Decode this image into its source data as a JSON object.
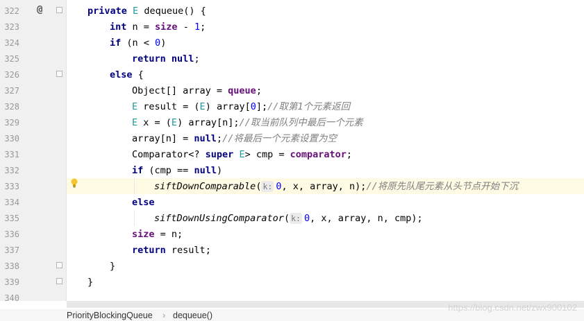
{
  "editor": {
    "line_numbers": [
      "322",
      "323",
      "324",
      "325",
      "326",
      "327",
      "328",
      "329",
      "330",
      "331",
      "332",
      "333",
      "334",
      "335",
      "336",
      "337",
      "338",
      "339",
      "340"
    ],
    "code": {
      "l322": {
        "kw_private": "private",
        "type_e": "E",
        "name": "dequeue() {"
      },
      "l323": {
        "kw_int": "int",
        "rest1": "n = ",
        "fld_size": "size",
        "rest2": " - ",
        "num1": "1",
        "rest3": ";"
      },
      "l324": {
        "kw_if": "if",
        "rest1": "(n < ",
        "num0": "0",
        "rest2": ")"
      },
      "l325": {
        "kw_return": "return",
        "kw_null": "null",
        "semi": ";"
      },
      "l326": {
        "kw_else": "else",
        "brace": "{"
      },
      "l327": {
        "rest1": "Object[] array = ",
        "fld_queue": "queue",
        "semi": ";"
      },
      "l328": {
        "type_e": "E",
        "rest1": " result = (",
        "type_e2": "E",
        "rest2": ") array[",
        "num0": "0",
        "rest3": "];",
        "comment": "//取第1个元素返回"
      },
      "l329": {
        "type_e": "E",
        "rest1": " x = (",
        "type_e2": "E",
        "rest2": ") array[n];",
        "comment": "//取当前队列中最后一个元素"
      },
      "l330": {
        "rest1": "array[n] = ",
        "kw_null": "null",
        "rest2": ";",
        "comment": "//将最后一个元素设置为空"
      },
      "l331": {
        "rest1": "Comparator<? ",
        "kw_super": "super",
        "type_e": "E",
        "rest2": "> cmp = ",
        "fld_comparator": "comparator",
        "semi": ";"
      },
      "l332": {
        "kw_if": "if",
        "rest1": "(cmp == ",
        "kw_null": "null",
        "rest2": ")"
      },
      "l333": {
        "method": "siftDownComparable",
        "paren": "(",
        "hint": "k:",
        "num0": "0",
        "rest1": ", x, array, n);",
        "comment": "//将原先队尾元素从头节点开始下沉"
      },
      "l334": {
        "kw_else": "else"
      },
      "l335": {
        "method": "siftDownUsingComparator",
        "paren": "(",
        "hint": "k:",
        "num0": "0",
        "rest1": ", x, array, n, cmp);"
      },
      "l336": {
        "fld_size": "size",
        "rest1": " = n;"
      },
      "l337": {
        "kw_return": "return",
        "rest1": "result;"
      },
      "l338": {
        "brace": "}"
      },
      "l339": {
        "brace": "}"
      }
    }
  },
  "breadcrumb": {
    "class_name": "PriorityBlockingQueue",
    "separator": "›",
    "method_name": "dequeue()"
  },
  "watermark": "https://blog.csdn.net/zwx900102",
  "icons": {
    "override": "@",
    "intention": "lightbulb-icon"
  },
  "colors": {
    "keyword": "#000080",
    "number": "#0000ff",
    "generic": "#20999d",
    "field": "#660e7a",
    "comment": "#808080",
    "highlight": "#fffae3"
  }
}
